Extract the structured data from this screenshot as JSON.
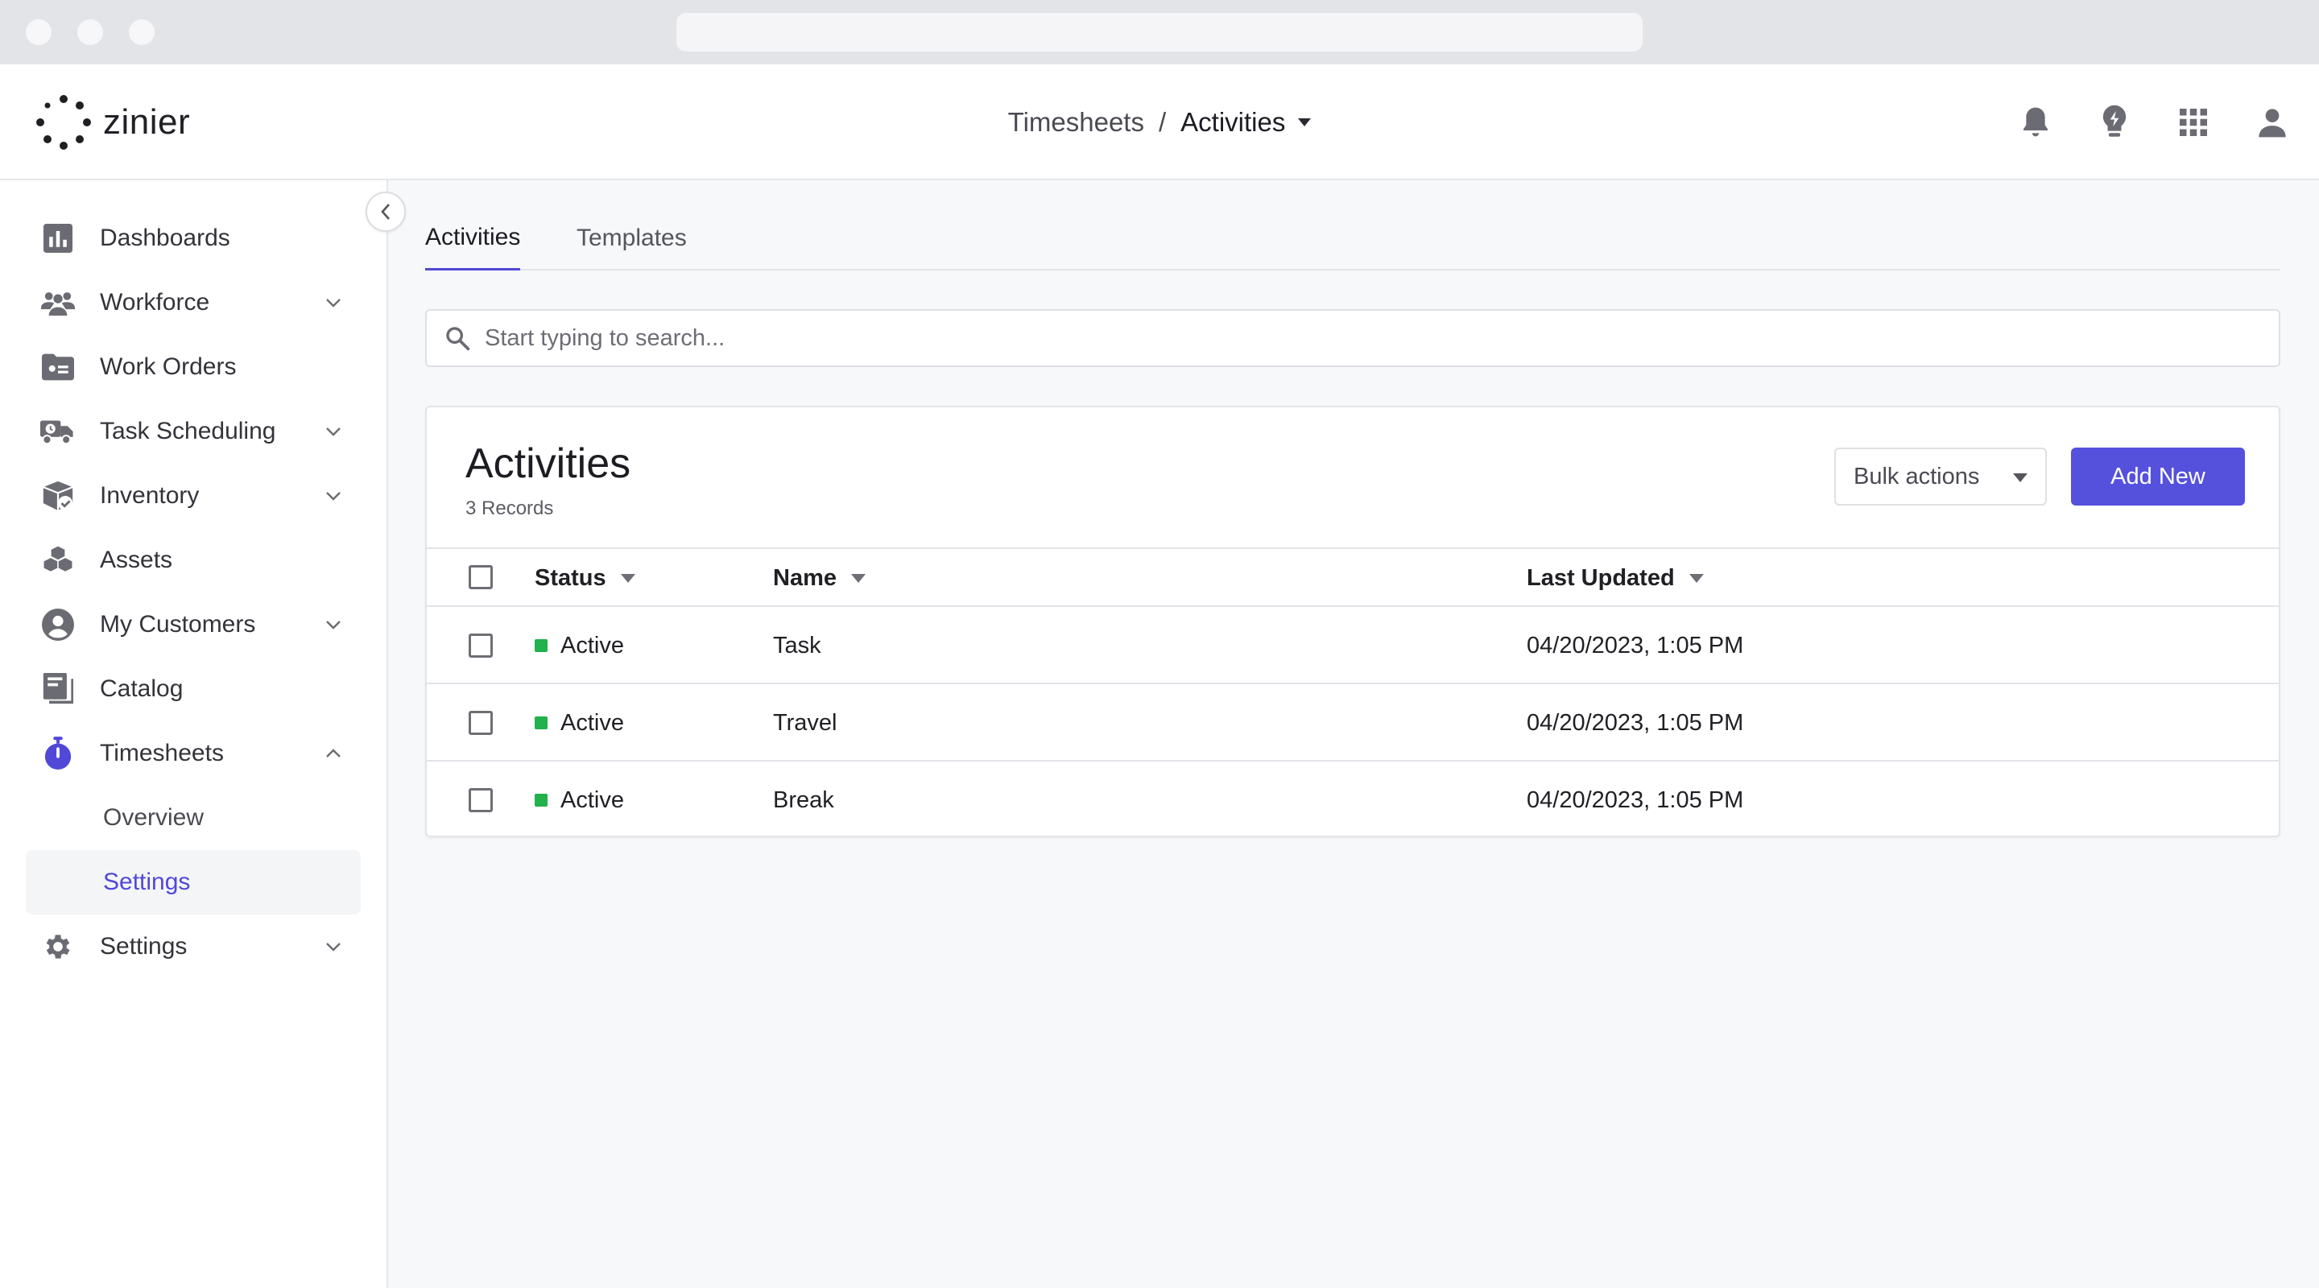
{
  "app": {
    "brand": "zinier",
    "colors": {
      "accent": "#5148d8",
      "primary_button": "#5551dc",
      "status_active": "#22b14c"
    }
  },
  "header": {
    "breadcrumb": {
      "parent": "Timesheets",
      "separator": "/",
      "current": "Activities"
    },
    "icons": [
      "bell-icon",
      "lightbulb-icon",
      "apps-grid-icon",
      "user-icon"
    ]
  },
  "sidebar": {
    "items": [
      {
        "label": "Dashboards",
        "icon": "bar-chart-icon",
        "expandable": false
      },
      {
        "label": "Workforce",
        "icon": "people-icon",
        "expandable": true
      },
      {
        "label": "Work Orders",
        "icon": "folder-card-icon",
        "expandable": false
      },
      {
        "label": "Task Scheduling",
        "icon": "truck-clock-icon",
        "expandable": true
      },
      {
        "label": "Inventory",
        "icon": "box-check-icon",
        "expandable": true
      },
      {
        "label": "Assets",
        "icon": "cubes-icon",
        "expandable": false
      },
      {
        "label": "My Customers",
        "icon": "account-circle-icon",
        "expandable": true
      },
      {
        "label": "Catalog",
        "icon": "book-icon",
        "expandable": false
      },
      {
        "label": "Timesheets",
        "icon": "stopwatch-icon",
        "expandable": true,
        "expanded": true
      },
      {
        "label": "Settings",
        "icon": "gear-icon",
        "expandable": true
      }
    ],
    "timesheets_sub": [
      {
        "label": "Overview",
        "active": false
      },
      {
        "label": "Settings",
        "active": true
      }
    ]
  },
  "tabs": [
    {
      "label": "Activities",
      "active": true
    },
    {
      "label": "Templates",
      "active": false
    }
  ],
  "search": {
    "placeholder": "Start typing to search...",
    "value": ""
  },
  "card": {
    "title": "Activities",
    "subtitle": "3 Records",
    "bulk_actions_label": "Bulk actions",
    "add_new_label": "Add New"
  },
  "table": {
    "columns": [
      "Status",
      "Name",
      "Last Updated"
    ],
    "rows": [
      {
        "status": "Active",
        "name": "Task",
        "last_updated": "04/20/2023, 1:05 PM"
      },
      {
        "status": "Active",
        "name": "Travel",
        "last_updated": "04/20/2023, 1:05 PM"
      },
      {
        "status": "Active",
        "name": "Break",
        "last_updated": "04/20/2023, 1:05 PM"
      }
    ]
  }
}
